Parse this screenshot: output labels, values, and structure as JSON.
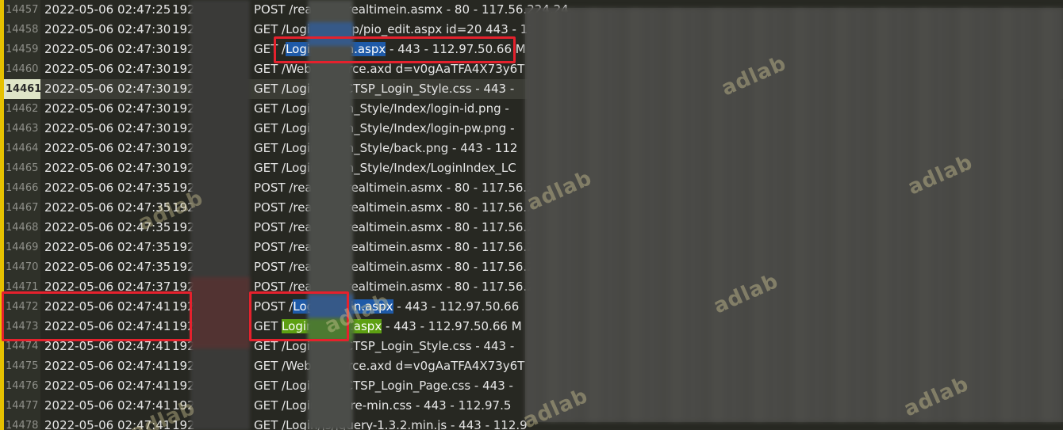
{
  "log": {
    "current_line": "14461",
    "lines": [
      {
        "no": "14457",
        "ts": "2022-05-06 02:47:25",
        "ip": "192",
        "req": "POST /realtime/realtimein.asmx - 80 - 117.56.224.24"
      },
      {
        "no": "14458",
        "ts": "2022-05-06 02:47:30",
        "ip": "192",
        "req": "GET /Login/popup/pio_edit.aspx id=20 443 - 112"
      },
      {
        "no": "14459",
        "ts": "2022-05-06 02:47:30",
        "ip": "192",
        "req_pre": "GET /",
        "req_hl": "Login/Login.aspx",
        "req_post": " - 443 - 112.97.50.66 M"
      },
      {
        "no": "14460",
        "ts": "2022-05-06 02:47:30",
        "ip": "192",
        "req": "GET /WebResource.axd d=v0gAaTFA4X73y6T"
      },
      {
        "no": "14461",
        "ts": "2022-05-06 02:47:30",
        "ip": "192",
        "req": "GET /Login/css/CTSP_Login_Style.css - 443 -"
      },
      {
        "no": "14462",
        "ts": "2022-05-06 02:47:30",
        "ip": "192",
        "req": "GET /Login/Login_Style/Index/login-id.png -"
      },
      {
        "no": "14463",
        "ts": "2022-05-06 02:47:30",
        "ip": "192",
        "req": "GET /Login/Login_Style/Index/login-pw.png -"
      },
      {
        "no": "14464",
        "ts": "2022-05-06 02:47:30",
        "ip": "192",
        "req": "GET /Login/Login_Style/back.png - 443 - 112"
      },
      {
        "no": "14465",
        "ts": "2022-05-06 02:47:30",
        "ip": "192",
        "req": "GET /Login/Login_Style/Index/LoginIndex_LC"
      },
      {
        "no": "14466",
        "ts": "2022-05-06 02:47:35",
        "ip": "192",
        "req": "POST /realtime/realtimein.asmx - 80 - 117.56.224.24"
      },
      {
        "no": "14467",
        "ts": "2022-05-06 02:47:35",
        "ip": "192",
        "req": "POST /realtime/realtimein.asmx - 80 - 117.56.224.24"
      },
      {
        "no": "14468",
        "ts": "2022-05-06 02:47:35",
        "ip": "192",
        "req": "POST /realtime/realtimein.asmx - 80 - 117.56.224.24"
      },
      {
        "no": "14469",
        "ts": "2022-05-06 02:47:35",
        "ip": "192",
        "req": "POST /realtime/realtimein.asmx - 80 - 117.56.224.24"
      },
      {
        "no": "14470",
        "ts": "2022-05-06 02:47:35",
        "ip": "192",
        "req": "POST /realtime/realtimein.asmx - 80 - 117.56.224.24"
      },
      {
        "no": "14471",
        "ts": "2022-05-06 02:47:37",
        "ip": "192",
        "req": "POST /realtime/realtimein.asmx - 80 - 117.56.224.24"
      },
      {
        "no": "14472",
        "ts": "2022-05-06 02:47:41",
        "ip": "192",
        "req_pre": "POST /",
        "req_hl": "Login/Login.aspx",
        "req_post": " - 443 - 112.97.50.66"
      },
      {
        "no": "14473",
        "ts": "2022-05-06 02:47:41",
        "ip": "192",
        "req_pre": "GET ",
        "req_hl_green": "Login/Login.aspx",
        "req_post": " - 443 - 112.97.50.66 M"
      },
      {
        "no": "14474",
        "ts": "2022-05-06 02:47:41",
        "ip": "192",
        "req": "GET /Login/css/CTSP_Login_Style.css - 443 -"
      },
      {
        "no": "14475",
        "ts": "2022-05-06 02:47:41",
        "ip": "192",
        "req": "GET /WebResource.axd d=v0gAaTFA4X73y6T"
      },
      {
        "no": "14476",
        "ts": "2022-05-06 02:47:41",
        "ip": "192",
        "req": "GET /Login/css/CTSP_Login_Page.css - 443 -"
      },
      {
        "no": "14477",
        "ts": "2022-05-06 02:47:41",
        "ip": "192",
        "req": "GET /Login/js/pure-min.css - 443 - 112.97.5"
      },
      {
        "no": "14478",
        "ts": "2022-05-06 02:47:41",
        "ip": "192",
        "req": "GET /Login/js/jquery-1.3.2.min.js - 443 - 112.9"
      }
    ]
  },
  "watermark": {
    "text": "adlab"
  },
  "colors": {
    "background": "#272822",
    "gutter_accent": "#e6c100",
    "annotation": "#e5212d",
    "highlight_blue": "#1e5aa8",
    "highlight_green": "#5d9f12"
  }
}
